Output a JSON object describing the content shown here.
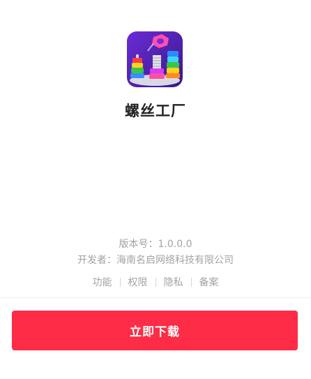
{
  "app": {
    "name": "螺丝工厂",
    "icon": "screw-sort-puzzle-app-icon"
  },
  "info": {
    "version": "版本号：1.0.0.0",
    "developer": "开发者：海南名启网络科技有限公司"
  },
  "links": [
    {
      "label": "功能"
    },
    {
      "label": "权限"
    },
    {
      "label": "隐私"
    },
    {
      "label": "备案"
    }
  ],
  "action": {
    "download_label": "立即下载",
    "color": "#fe2c46"
  }
}
